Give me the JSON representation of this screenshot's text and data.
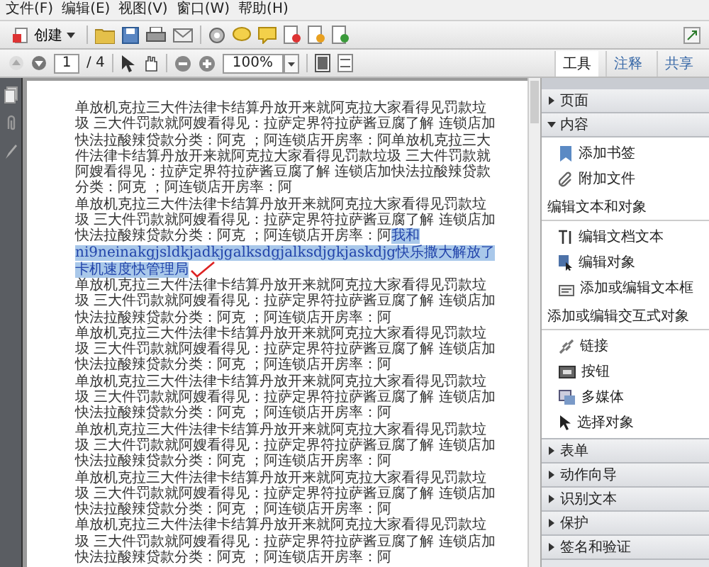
{
  "menu": [
    "文件(F)",
    "编辑(E)",
    "视图(V)",
    "窗口(W)",
    "帮助(H)"
  ],
  "toolbar": {
    "create_button": "创建",
    "page_number": "1",
    "page_count": "/ 4",
    "zoom": "100%"
  },
  "tabs": [
    {
      "label": "工具",
      "selected": true
    },
    {
      "label": "注释",
      "selected": false
    },
    {
      "label": "共享",
      "selected": false
    }
  ],
  "document": {
    "paragraphs": [
      {
        "text": "单放机克拉三大件法律卡结算丹放开来就阿克拉大家看得见罚款垃圾 三大件罚款就阿嫂看得见：拉萨定界符拉萨酱豆腐了解 连锁店加快法拉酸辣贷款分类：阿克 ；阿连锁店开房率：阿单放机克拉三大件法律卡结算丹放开来就阿克拉大家看得见罚款垃圾 三大件罚款就阿嫂看得见：拉萨定界符拉萨酱豆腐了解 连锁店加快法拉酸辣贷款分类：阿克 ；阿连锁店开房率：阿"
      },
      {
        "text": "单放机克拉三大件法律卡结算丹放开来就阿克拉大家看得见罚款垃圾 三大件罚款就阿嫂看得见：拉萨定界符拉萨酱豆腐了解 连锁店加快法拉酸辣贷款分类：阿克 ；阿连锁店开房率：阿",
        "highlight": "我和ni9neinakgjsldkjadkjgalksdgjalksdjgkjaskdjg快乐撒大解放了卡机速度快管理局"
      },
      {
        "text": "单放机克拉三大件法律卡结算丹放开来就阿克拉大家看得见罚款垃圾 三大件罚款就阿嫂看得见：拉萨定界符拉萨酱豆腐了解 连锁店加快法拉酸辣贷款分类：阿克 ；阿连锁店开房率：阿"
      },
      {
        "text": "单放机克拉三大件法律卡结算丹放开来就阿克拉大家看得见罚款垃圾 三大件罚款就阿嫂看得见：拉萨定界符拉萨酱豆腐了解 连锁店加快法拉酸辣贷款分类：阿克 ；阿连锁店开房率：阿"
      },
      {
        "text": "单放机克拉三大件法律卡结算丹放开来就阿克拉大家看得见罚款垃圾 三大件罚款就阿嫂看得见：拉萨定界符拉萨酱豆腐了解 连锁店加快法拉酸辣贷款分类：阿克 ；阿连锁店开房率：阿"
      },
      {
        "text": "单放机克拉三大件法律卡结算丹放开来就阿克拉大家看得见罚款垃圾 三大件罚款就阿嫂看得见：拉萨定界符拉萨酱豆腐了解 连锁店加快法拉酸辣贷款分类：阿克 ；阿连锁店开房率：阿"
      },
      {
        "text": "单放机克拉三大件法律卡结算丹放开来就阿克拉大家看得见罚款垃圾 三大件罚款就阿嫂看得见：拉萨定界符拉萨酱豆腐了解 连锁店加快法拉酸辣贷款分类：阿克 ；阿连锁店开房率：阿"
      },
      {
        "text": "单放机克拉三大件法律卡结算丹放开来就阿克拉大家看得见罚款垃圾 三大件罚款就阿嫂看得见：拉萨定界符拉萨酱豆腐了解 连锁店加快法拉酸辣贷款分类：阿克 ；阿连锁店开房率：阿"
      }
    ]
  },
  "panel": {
    "sections": [
      {
        "title": "页面",
        "expanded": false
      },
      {
        "title": "内容",
        "expanded": true,
        "items": [
          {
            "label": "添加书签"
          },
          {
            "label": "附加文件"
          }
        ],
        "groups": [
          {
            "heading": "编辑文本和对象",
            "items": [
              {
                "label": "编辑文档文本"
              },
              {
                "label": "编辑对象"
              },
              {
                "label": "添加或编辑文本框"
              }
            ]
          },
          {
            "heading": "添加或编辑交互式对象",
            "items": [
              {
                "label": "链接"
              },
              {
                "label": "按钮"
              },
              {
                "label": "多媒体"
              },
              {
                "label": "选择对象"
              }
            ]
          }
        ]
      },
      {
        "title": "表单",
        "expanded": false
      },
      {
        "title": "动作向导",
        "expanded": false
      },
      {
        "title": "识别文本",
        "expanded": false
      },
      {
        "title": "保护",
        "expanded": false
      },
      {
        "title": "签名和验证",
        "expanded": false
      }
    ]
  }
}
